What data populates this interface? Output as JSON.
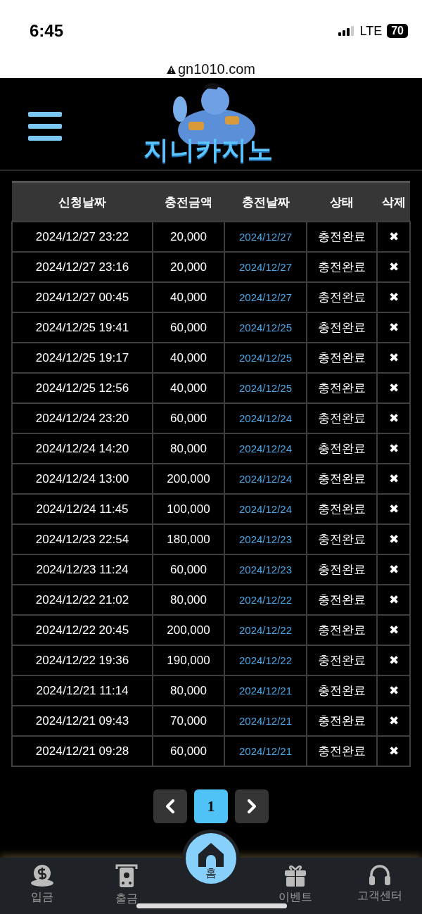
{
  "status_bar": {
    "time": "6:45",
    "network": "LTE",
    "battery": "70"
  },
  "browser": {
    "url": "gn1010.com"
  },
  "header": {
    "logo_text": "지니카지노"
  },
  "table": {
    "columns": [
      "신청날짜",
      "충전금액",
      "충전날짜",
      "상태",
      "삭제"
    ],
    "rows": [
      {
        "requested": "2024/12/27 23:22",
        "amount": "20,000",
        "charged": "2024/12/27",
        "status": "충전완료",
        "delete": "✖"
      },
      {
        "requested": "2024/12/27 23:16",
        "amount": "20,000",
        "charged": "2024/12/27",
        "status": "충전완료",
        "delete": "✖"
      },
      {
        "requested": "2024/12/27 00:45",
        "amount": "40,000",
        "charged": "2024/12/27",
        "status": "충전완료",
        "delete": "✖"
      },
      {
        "requested": "2024/12/25 19:41",
        "amount": "60,000",
        "charged": "2024/12/25",
        "status": "충전완료",
        "delete": "✖"
      },
      {
        "requested": "2024/12/25 19:17",
        "amount": "40,000",
        "charged": "2024/12/25",
        "status": "충전완료",
        "delete": "✖"
      },
      {
        "requested": "2024/12/25 12:56",
        "amount": "40,000",
        "charged": "2024/12/25",
        "status": "충전완료",
        "delete": "✖"
      },
      {
        "requested": "2024/12/24 23:20",
        "amount": "60,000",
        "charged": "2024/12/24",
        "status": "충전완료",
        "delete": "✖"
      },
      {
        "requested": "2024/12/24 14:20",
        "amount": "80,000",
        "charged": "2024/12/24",
        "status": "충전완료",
        "delete": "✖"
      },
      {
        "requested": "2024/12/24 13:00",
        "amount": "200,000",
        "charged": "2024/12/24",
        "status": "충전완료",
        "delete": "✖"
      },
      {
        "requested": "2024/12/24 11:45",
        "amount": "100,000",
        "charged": "2024/12/24",
        "status": "충전완료",
        "delete": "✖"
      },
      {
        "requested": "2024/12/23 22:54",
        "amount": "180,000",
        "charged": "2024/12/23",
        "status": "충전완료",
        "delete": "✖"
      },
      {
        "requested": "2024/12/23 11:24",
        "amount": "60,000",
        "charged": "2024/12/23",
        "status": "충전완료",
        "delete": "✖"
      },
      {
        "requested": "2024/12/22 21:02",
        "amount": "80,000",
        "charged": "2024/12/22",
        "status": "충전완료",
        "delete": "✖"
      },
      {
        "requested": "2024/12/22 20:45",
        "amount": "200,000",
        "charged": "2024/12/22",
        "status": "충전완료",
        "delete": "✖"
      },
      {
        "requested": "2024/12/22 19:36",
        "amount": "190,000",
        "charged": "2024/12/22",
        "status": "충전완료",
        "delete": "✖"
      },
      {
        "requested": "2024/12/21 11:14",
        "amount": "80,000",
        "charged": "2024/12/21",
        "status": "충전완료",
        "delete": "✖"
      },
      {
        "requested": "2024/12/21 09:43",
        "amount": "70,000",
        "charged": "2024/12/21",
        "status": "충전완료",
        "delete": "✖"
      },
      {
        "requested": "2024/12/21 09:28",
        "amount": "60,000",
        "charged": "2024/12/21",
        "status": "충전완료",
        "delete": "✖"
      }
    ]
  },
  "pagination": {
    "pages": [
      {
        "label": "1",
        "selected": true
      }
    ]
  },
  "bottom_nav": [
    {
      "kind": "deposit",
      "label": "입금",
      "selected": false
    },
    {
      "kind": "withdraw",
      "label": "출금",
      "selected": false
    },
    {
      "kind": "home",
      "label": "홈",
      "selected": true
    },
    {
      "kind": "event",
      "label": "이벤트",
      "selected": false
    },
    {
      "kind": "support",
      "label": "고객센터",
      "selected": false
    }
  ]
}
